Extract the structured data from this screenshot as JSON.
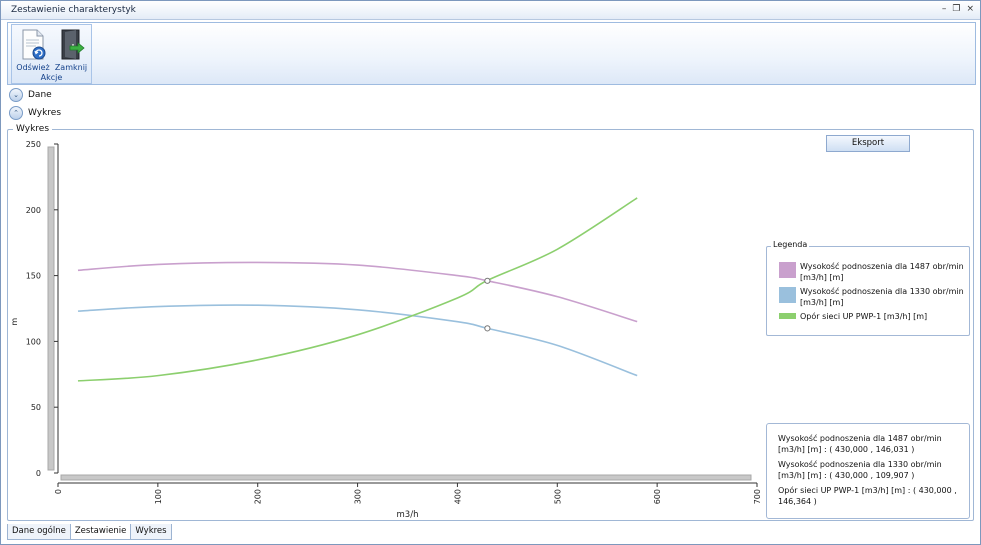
{
  "window": {
    "title": "Zestawienie charakterystyk",
    "minimize_glyph": "–",
    "restore_glyph": "❐",
    "close_glyph": "×"
  },
  "ribbon": {
    "refresh_label": "Odśwież",
    "close_label": "Zamknij",
    "group_label": "Akcje",
    "refresh_icon": "document-refresh-icon",
    "close_icon": "door-exit-icon"
  },
  "sections": {
    "data_label": "Dane",
    "chart_label": "Wykres",
    "data_expand_glyph": "⌄",
    "chart_expand_glyph": "⌃"
  },
  "panel": {
    "title": "Wykres",
    "export_label": "Eksport"
  },
  "legend": {
    "title": "Legenda",
    "items": [
      {
        "label": "Wysokość podnoszenia dla 1487 obr/min [m3/h] [m]",
        "color": "#c9a0cd"
      },
      {
        "label": "Wysokość podnoszenia dla 1330 obr/min [m3/h] [m]",
        "color": "#9ac0dd"
      },
      {
        "label": "Opór sieci UP PWP-1 [m3/h] [m]",
        "color": "#8ccf6e"
      }
    ]
  },
  "info": {
    "lines": [
      "Wysokość podnoszenia dla 1487 obr/min [m3/h] [m] : ( 430,000 ,  146,031 )",
      "Wysokość podnoszenia dla 1330 obr/min [m3/h] [m] : ( 430,000 ,  109,907 )",
      "Opór sieci UP PWP-1 [m3/h] [m] : ( 430,000 ,  146,364 )"
    ]
  },
  "tabs": [
    "Dane ogólne",
    "Zestawienie",
    "Wykres"
  ],
  "active_tab": 1,
  "chart_data": {
    "type": "line",
    "xlabel": "m3/h",
    "ylabel": "m",
    "xlim": [
      0,
      700
    ],
    "ylim": [
      0,
      250
    ],
    "xticks": [
      "0",
      "100",
      "200",
      "300",
      "400",
      "500",
      "600",
      "700"
    ],
    "yticks": [
      "0",
      "50",
      "100",
      "150",
      "200",
      "250"
    ],
    "series": [
      {
        "name": "Wysokość podnoszenia dla 1487 obr/min [m3/h] [m]",
        "color": "#c9a0cd",
        "x": [
          20,
          100,
          200,
          300,
          400,
          430,
          500,
          580
        ],
        "y": [
          154,
          158.5,
          160,
          158,
          150,
          146.031,
          134,
          115
        ]
      },
      {
        "name": "Wysokość podnoszenia dla 1330 obr/min [m3/h] [m]",
        "color": "#9ac0dd",
        "x": [
          20,
          100,
          200,
          300,
          400,
          430,
          500,
          580
        ],
        "y": [
          123,
          126.5,
          127.5,
          124,
          115,
          109.907,
          97,
          74
        ]
      },
      {
        "name": "Opór sieci UP PWP-1 [m3/h] [m]",
        "color": "#8ccf6e",
        "x": [
          20,
          100,
          200,
          300,
          400,
          430,
          500,
          580
        ],
        "y": [
          70,
          74,
          86,
          105,
          133,
          146.364,
          170,
          209
        ]
      }
    ],
    "markers": [
      {
        "x": 430,
        "y": 146.031
      },
      {
        "x": 430,
        "y": 109.907
      }
    ]
  }
}
